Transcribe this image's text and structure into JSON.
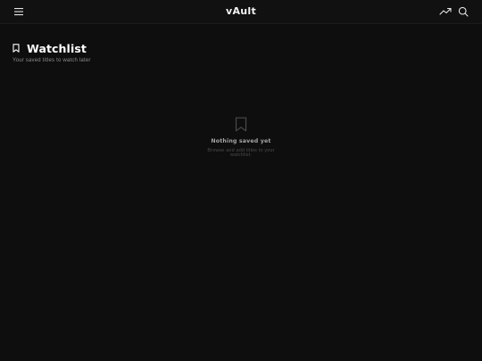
{
  "topbar": {
    "logo": "vAult",
    "icons": [
      "menu-icon",
      "trending-icon",
      "search-icon"
    ]
  },
  "header": {
    "title": "Watchlist",
    "subtitle": "Your saved titles to watch later",
    "icon": "bookmark-icon"
  },
  "empty_state": {
    "icon": "bookmark-outline-icon",
    "title": "Nothing saved yet",
    "message": "Browse and add titles to your watchlist."
  },
  "colors": {
    "background": "#0e0e0e",
    "topbar": "#111111",
    "text": "#ffffff",
    "muted": "#8c8c8c",
    "faint": "#4c4c4c"
  }
}
